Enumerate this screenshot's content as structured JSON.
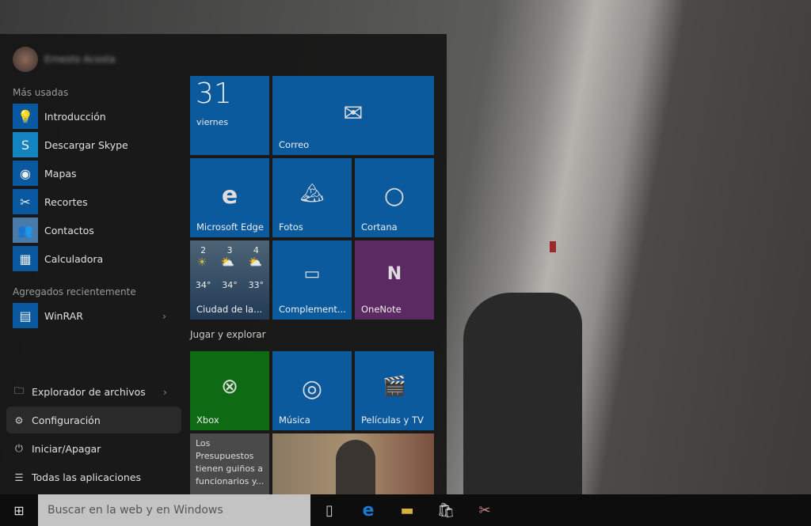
{
  "user": {
    "name": "Ernesto Acosta"
  },
  "most_used": {
    "label": "Más usadas",
    "items": [
      {
        "label": "Introducción",
        "icon": "lightbulb-icon",
        "color": "#0a58a0"
      },
      {
        "label": "Descargar Skype",
        "icon": "skype-icon",
        "color": "#1384bf"
      },
      {
        "label": "Mapas",
        "icon": "maps-icon",
        "color": "#0a58a0"
      },
      {
        "label": "Recortes",
        "icon": "snipping-icon",
        "color": "#0a58a0"
      },
      {
        "label": "Contactos",
        "icon": "people-icon",
        "color": "#4a7aa8"
      },
      {
        "label": "Calculadora",
        "icon": "calculator-icon",
        "color": "#0a58a0"
      }
    ]
  },
  "recent": {
    "label": "Agregados recientemente",
    "items": [
      {
        "label": "WinRAR",
        "icon": "winrar-icon"
      }
    ]
  },
  "system": [
    {
      "label": "Explorador de archivos",
      "icon": "file-explorer-icon"
    },
    {
      "label": "Configuración",
      "icon": "gear-icon"
    },
    {
      "label": "Iniciar/Apagar",
      "icon": "power-icon"
    },
    {
      "label": "Todas las aplicaciones",
      "icon": "list-icon"
    }
  ],
  "tiles": {
    "calendar": {
      "day": "31",
      "weekday": "viernes"
    },
    "mail": "Correo",
    "edge": "Microsoft Edge",
    "photos": "Fotos",
    "cortana": "Cortana",
    "weather": {
      "label": "Ciudad de la...",
      "days": [
        "2",
        "3",
        "4"
      ],
      "temps": [
        "34°",
        "34°",
        "33°"
      ]
    },
    "companion": "Complement...",
    "onenote": "OneNote",
    "group2": "Jugar y explorar",
    "xbox": "Xbox",
    "music": "Música",
    "movies": "Películas y TV",
    "news": "Los Presupuestos tienen guiños a funcionarios y..."
  },
  "colors": {
    "tile_blue": "#0b5a9e",
    "onenote": "#5c2a62",
    "xbox": "#0f6a14"
  },
  "taskbar": {
    "search_placeholder": "Buscar en la web y en Windows"
  }
}
